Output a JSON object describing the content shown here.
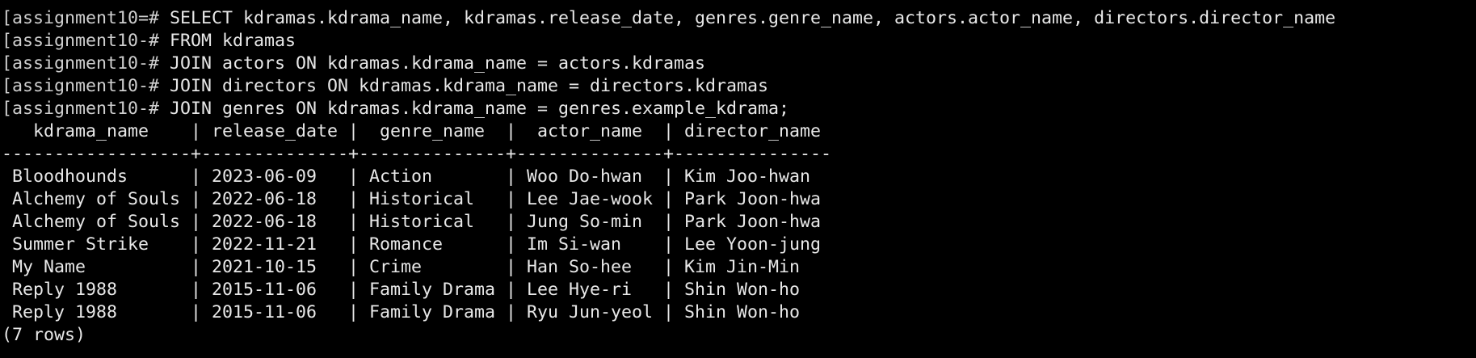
{
  "session": {
    "commands": [
      {
        "prompt": "[assignment10=# ",
        "text": "SELECT kdramas.kdrama_name, kdramas.release_date, genres.genre_name, actors.actor_name, directors.director_name"
      },
      {
        "prompt": "[assignment10-# ",
        "text": "FROM kdramas"
      },
      {
        "prompt": "[assignment10-# ",
        "text": "JOIN actors ON kdramas.kdrama_name = actors.kdramas"
      },
      {
        "prompt": "[assignment10-# ",
        "text": "JOIN directors ON kdramas.kdrama_name = directors.kdramas"
      },
      {
        "prompt": "[assignment10-# ",
        "text": "JOIN genres ON kdramas.kdrama_name = genres.example_kdrama;"
      }
    ]
  },
  "result": {
    "header": "   kdrama_name    | release_date |  genre_name  |  actor_name  | director_name",
    "separator": "------------------+--------------+--------------+--------------+---------------",
    "rows": [
      " Bloodhounds      | 2023-06-09   | Action       | Woo Do-hwan  | Kim Joo-hwan",
      " Alchemy of Souls | 2022-06-18   | Historical   | Lee Jae-wook | Park Joon-hwa",
      " Alchemy of Souls | 2022-06-18   | Historical   | Jung So-min  | Park Joon-hwa",
      " Summer Strike    | 2022-11-21   | Romance      | Im Si-wan    | Lee Yoon-jung",
      " My Name          | 2021-10-15   | Crime        | Han So-hee   | Kim Jin-Min",
      " Reply 1988       | 2015-11-06   | Family Drama | Lee Hye-ri   | Shin Won-ho",
      " Reply 1988       | 2015-11-06   | Family Drama | Ryu Jun-yeol | Shin Won-ho"
    ],
    "row_count": "(7 rows)"
  }
}
